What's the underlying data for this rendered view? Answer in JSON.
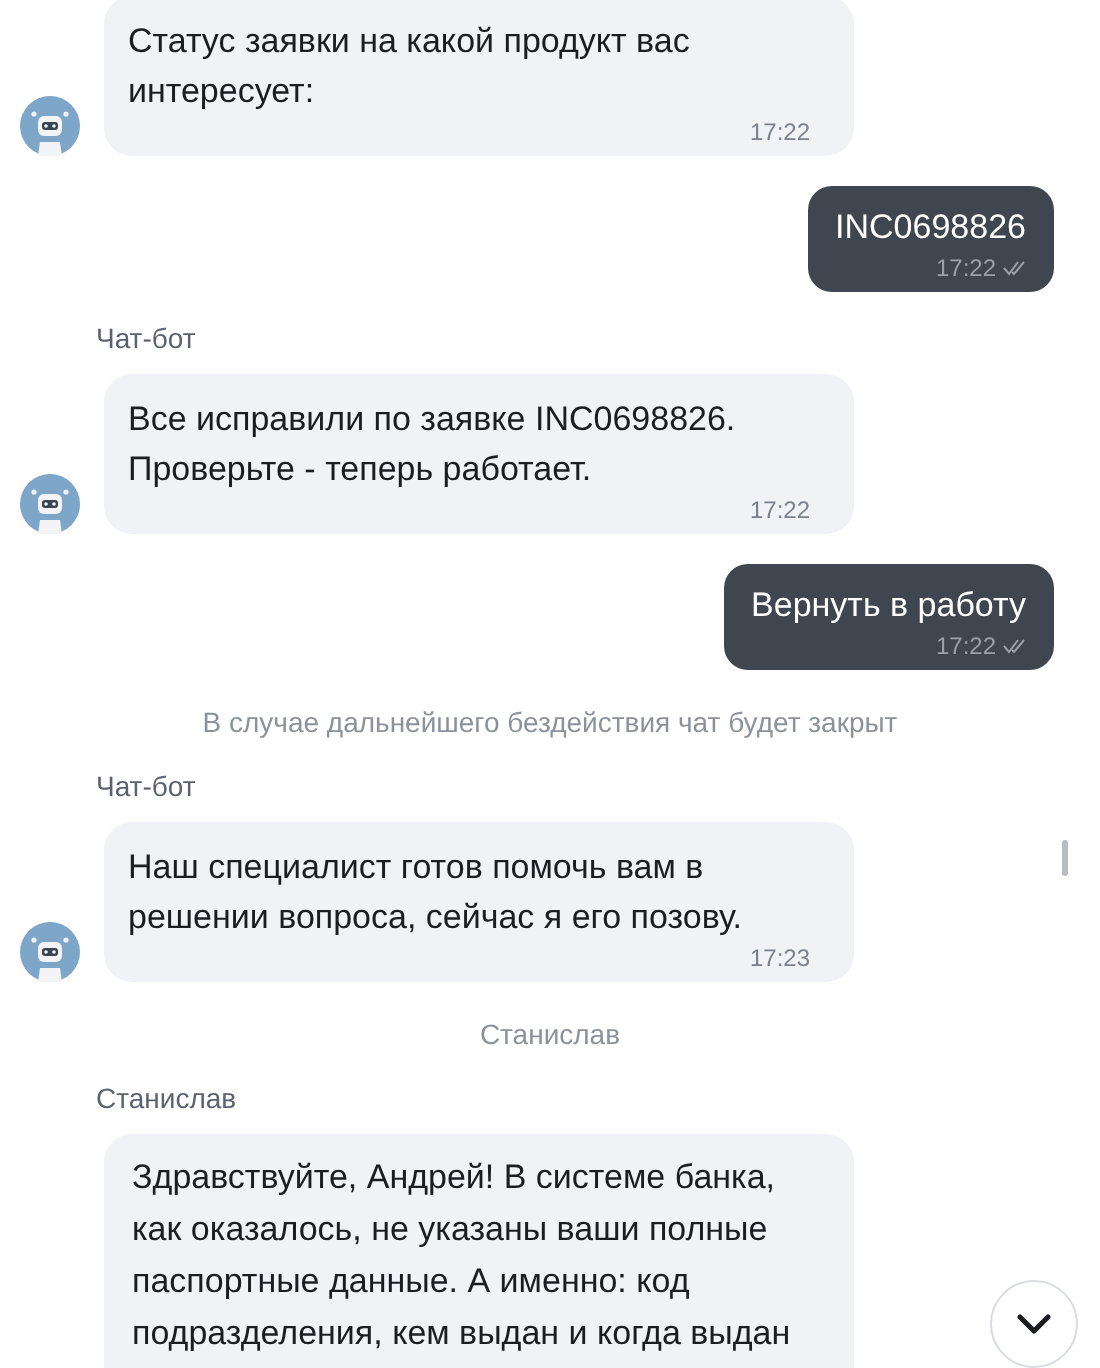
{
  "messages": [
    {
      "kind": "bot",
      "lines": [
        "Статус заявки на какой продукт вас",
        "интересует:"
      ],
      "time": "17:22",
      "avatar": true
    },
    {
      "kind": "user",
      "lines": [
        "INC0698826"
      ],
      "time": "17:22",
      "read": true
    },
    {
      "kind": "sender",
      "text": "Чат-бот"
    },
    {
      "kind": "bot",
      "lines": [
        "Все исправили по заявке INC0698826.",
        "Проверьте - теперь работает."
      ],
      "time": "17:22",
      "avatar": true
    },
    {
      "kind": "user",
      "lines": [
        "Вернуть в работу"
      ],
      "time": "17:22",
      "read": true
    },
    {
      "kind": "notice",
      "text": "В случае дальнейшего бездействия чат будет закрыт"
    },
    {
      "kind": "sender",
      "text": "Чат-бот"
    },
    {
      "kind": "bot",
      "lines": [
        "Наш специалист готов помочь вам в",
        "решении вопроса, сейчас я его позову."
      ],
      "time": "17:23",
      "avatar": true
    },
    {
      "kind": "notice",
      "text": "Станислав"
    },
    {
      "kind": "sender",
      "text": "Станислав"
    },
    {
      "kind": "bot",
      "lines": [
        "Здравствуйте, Андрей! В системе банка,",
        "как оказалось, не указаны ваши полные",
        "паспортные данные. А именно: код",
        "подразделения, кем выдан и когда выдан"
      ],
      "avatar": false
    }
  ]
}
